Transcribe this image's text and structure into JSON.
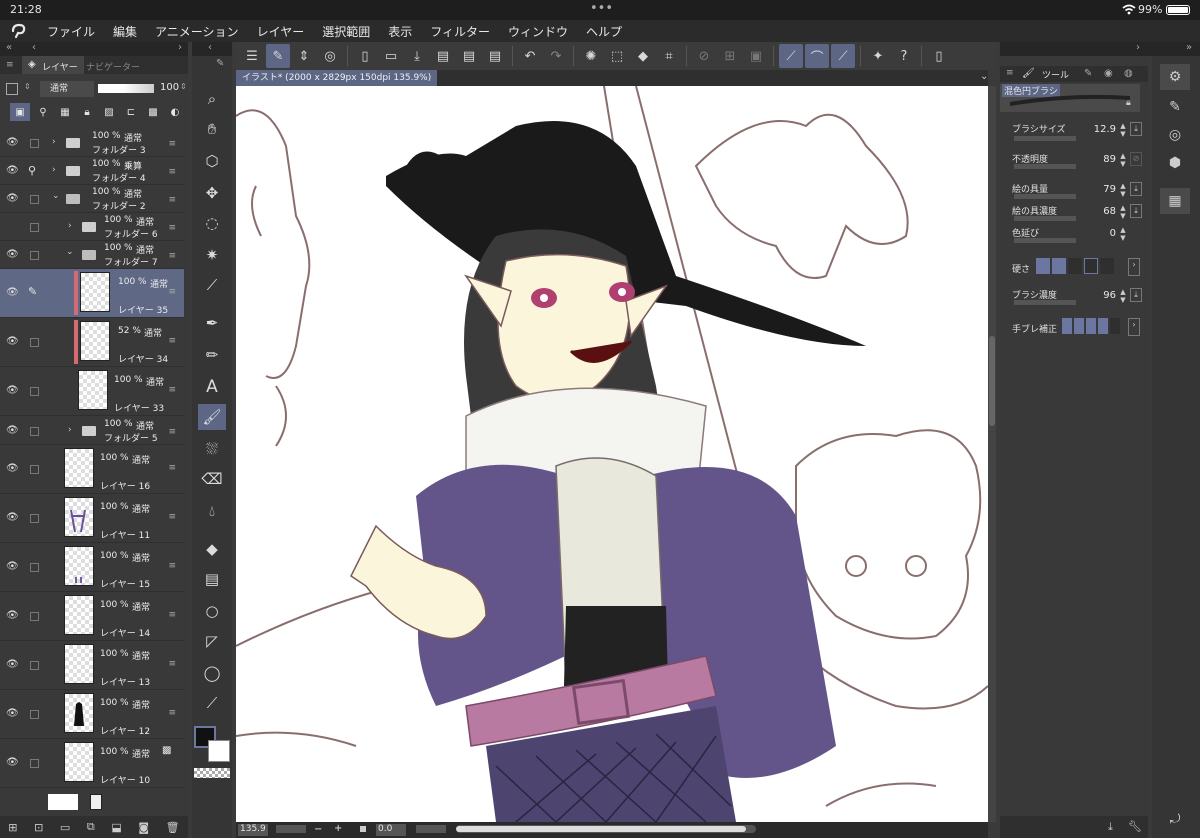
{
  "status": {
    "time": "21:28",
    "dots": "•••",
    "battery": "99%"
  },
  "menu": [
    "ファイル",
    "編集",
    "アニメーション",
    "レイヤー",
    "選択範囲",
    "表示",
    "フィルター",
    "ウィンドウ",
    "ヘルプ"
  ],
  "layer_panel": {
    "tab_layer": "レイヤー",
    "tab_navigator": "ナビゲーター",
    "blend_mode": "通常",
    "opacity": "100"
  },
  "layers": [
    {
      "pct": "100 %",
      "mode": "通常",
      "name": "フォルダー 3"
    },
    {
      "pct": "100 %",
      "mode": "乗算",
      "name": "フォルダー 4"
    },
    {
      "pct": "100 %",
      "mode": "通常",
      "name": "フォルダー 2"
    },
    {
      "pct": "100 %",
      "mode": "通常",
      "name": "フォルダー 6"
    },
    {
      "pct": "100 %",
      "mode": "通常",
      "name": "フォルダー 7"
    },
    {
      "pct": "100 %",
      "mode": "通常",
      "name": "レイヤー 35"
    },
    {
      "pct": "52 %",
      "mode": "通常",
      "name": "レイヤー 34"
    },
    {
      "pct": "100 %",
      "mode": "通常",
      "name": "レイヤー 33"
    },
    {
      "pct": "100 %",
      "mode": "通常",
      "name": "フォルダー 5"
    },
    {
      "pct": "100 %",
      "mode": "通常",
      "name": "レイヤー 16"
    },
    {
      "pct": "100 %",
      "mode": "通常",
      "name": "レイヤー 11"
    },
    {
      "pct": "100 %",
      "mode": "通常",
      "name": "レイヤー 15"
    },
    {
      "pct": "100 %",
      "mode": "通常",
      "name": "レイヤー 14"
    },
    {
      "pct": "100 %",
      "mode": "通常",
      "name": "レイヤー 13"
    },
    {
      "pct": "100 %",
      "mode": "通常",
      "name": "レイヤー 12"
    },
    {
      "pct": "100 %",
      "mode": "通常",
      "name": "レイヤー 10"
    }
  ],
  "document_tab": "イラスト* (2000 x 2829px 150dpi 135.9%)",
  "bottom": {
    "zoom": "135.9",
    "minus": "−",
    "plus": "+",
    "angle": "0.0"
  },
  "tool_panel": {
    "tab_tool": "ツール",
    "brush_name": "混色円ブラシ",
    "props": [
      {
        "label": "ブラシサイズ",
        "value": "12.9"
      },
      {
        "label": "不透明度",
        "value": "89"
      },
      {
        "label": "絵の具量",
        "value": "79"
      },
      {
        "label": "絵の具濃度",
        "value": "68"
      },
      {
        "label": "色延び",
        "value": "0"
      },
      {
        "label": "硬さ",
        "value": ""
      },
      {
        "label": "ブラシ濃度",
        "value": "96"
      },
      {
        "label": "手ブレ補正",
        "value": ""
      }
    ]
  },
  "colors": {
    "accent": "#5d6785",
    "main_color": "#111111",
    "sub_color": "#ffffff",
    "marker_red": "#d46a72"
  }
}
